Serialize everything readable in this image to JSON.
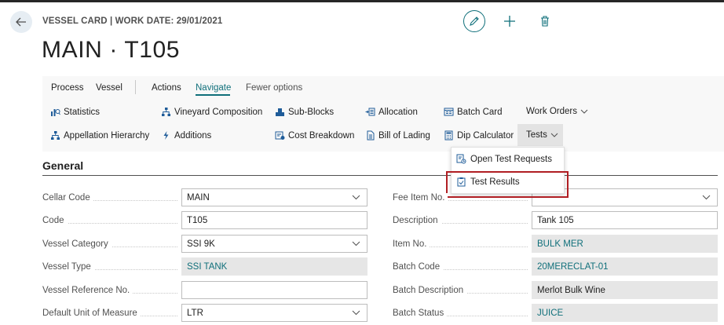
{
  "header": {
    "caption": "VESSEL CARD | WORK DATE: 29/01/2021",
    "title": "MAIN · T105"
  },
  "menu": {
    "process": "Process",
    "vessel": "Vessel",
    "actions": "Actions",
    "navigate": "Navigate",
    "fewer_options": "Fewer options"
  },
  "navigate": {
    "statistics": "Statistics",
    "vineyard_composition": "Vineyard Composition",
    "sub_blocks": "Sub-Blocks",
    "allocation": "Allocation",
    "batch_card": "Batch Card",
    "work_orders": "Work Orders",
    "appellation_hierarchy": "Appellation Hierarchy",
    "additions": "Additions",
    "cost_breakdown": "Cost Breakdown",
    "bill_of_lading": "Bill of Lading",
    "dip_calculator": "Dip Calculator",
    "tests": "Tests"
  },
  "tests_menu": {
    "open_test_requests": "Open Test Requests",
    "test_results": "Test Results"
  },
  "general": {
    "title": "General",
    "cellar_code": {
      "label": "Cellar Code",
      "value": "MAIN"
    },
    "code": {
      "label": "Code",
      "value": "T105"
    },
    "vessel_category": {
      "label": "Vessel Category",
      "value": "SSI 9K"
    },
    "vessel_type": {
      "label": "Vessel Type",
      "value": "SSI TANK"
    },
    "vessel_reference_no": {
      "label": "Vessel Reference No.",
      "value": ""
    },
    "default_uom": {
      "label": "Default Unit of Measure",
      "value": "LTR"
    },
    "fee_item_no": {
      "label": "Fee Item No.",
      "value": ""
    },
    "description": {
      "label": "Description",
      "value": "Tank 105"
    },
    "item_no": {
      "label": "Item No.",
      "value": "BULK MER"
    },
    "batch_code": {
      "label": "Batch Code",
      "value": "20MERECLAT-01"
    },
    "batch_description": {
      "label": "Batch Description",
      "value": "Merlot Bulk Wine"
    },
    "batch_status": {
      "label": "Batch Status",
      "value": "JUICE"
    }
  },
  "colors": {
    "accent": "#0f6f7a",
    "highlight_border": "#b01e23"
  }
}
